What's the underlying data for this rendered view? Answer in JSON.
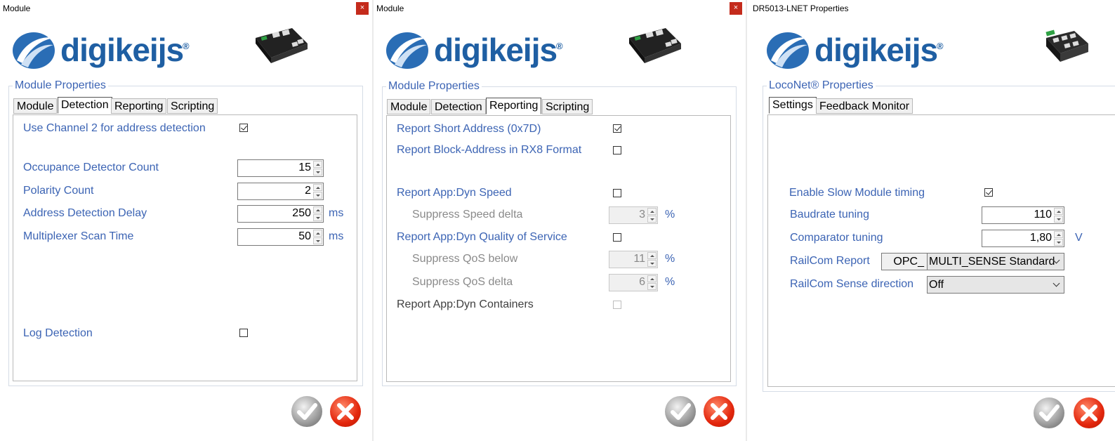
{
  "colors": {
    "label_blue": "#3c64b4",
    "logo_blue": "#1f5fa3",
    "close_red": "#c42b1c"
  },
  "logo_text": "digikeijs",
  "logo_reg": "®",
  "close_glyph": "×",
  "panels": [
    {
      "title": "Module",
      "group_title": "Module Properties",
      "tabs": [
        "Module",
        "Detection",
        "Reporting",
        "Scripting"
      ],
      "active_tab": "Detection",
      "fields": {
        "use_channel2": "Use Channel 2 for address detection",
        "occupance_count": "Occupance Detector Count",
        "occupance_count_value": "15",
        "polarity_count": "Polarity Count",
        "polarity_count_value": "2",
        "address_delay": "Address Detection Delay",
        "address_delay_value": "250",
        "address_delay_unit": "ms",
        "mux_scan": "Multiplexer Scan Time",
        "mux_scan_value": "50",
        "mux_scan_unit": "ms",
        "log_detection": "Log Detection"
      },
      "checks": {
        "use_channel2": true,
        "log_detection": false
      }
    },
    {
      "title": "Module",
      "group_title": "Module Properties",
      "tabs": [
        "Module",
        "Detection",
        "Reporting",
        "Scripting"
      ],
      "active_tab": "Reporting",
      "fields": {
        "short_address": "Report Short Address (0x7D)",
        "block_address": "Report Block-Address in RX8 Format",
        "dyn_speed": "Report App:Dyn Speed",
        "speed_delta": "Suppress Speed delta",
        "speed_delta_value": "3",
        "speed_delta_unit": "%",
        "dyn_qos": "Report App:Dyn Quality of Service",
        "qos_below": "Suppress QoS below",
        "qos_below_value": "11",
        "qos_below_unit": "%",
        "qos_delta": "Suppress QoS delta",
        "qos_delta_value": "6",
        "qos_delta_unit": "%",
        "dyn_containers": "Report App:Dyn Containers"
      },
      "checks": {
        "short_address": true,
        "block_address": false,
        "dyn_speed": false,
        "dyn_qos": false,
        "dyn_containers": false
      }
    },
    {
      "title": "DR5013-LNET Properties",
      "group_title": "LocoNet® Properties",
      "tabs": [
        "Settings",
        "Feedback Monitor"
      ],
      "active_tab": "Settings",
      "fields": {
        "slow_timing": "Enable Slow Module timing",
        "baudrate": "Baudrate tuning",
        "baudrate_value": "110",
        "comparator": "Comparator tuning",
        "comparator_value": "1,80",
        "comparator_unit": "V",
        "railcom_report": "RailCom Report",
        "railcom_report_prefix": "OPC_",
        "railcom_report_value": "MULTI_SENSE Standard",
        "railcom_sense": "RailCom Sense direction",
        "railcom_sense_value": "Off"
      },
      "checks": {
        "slow_timing": true
      }
    }
  ]
}
